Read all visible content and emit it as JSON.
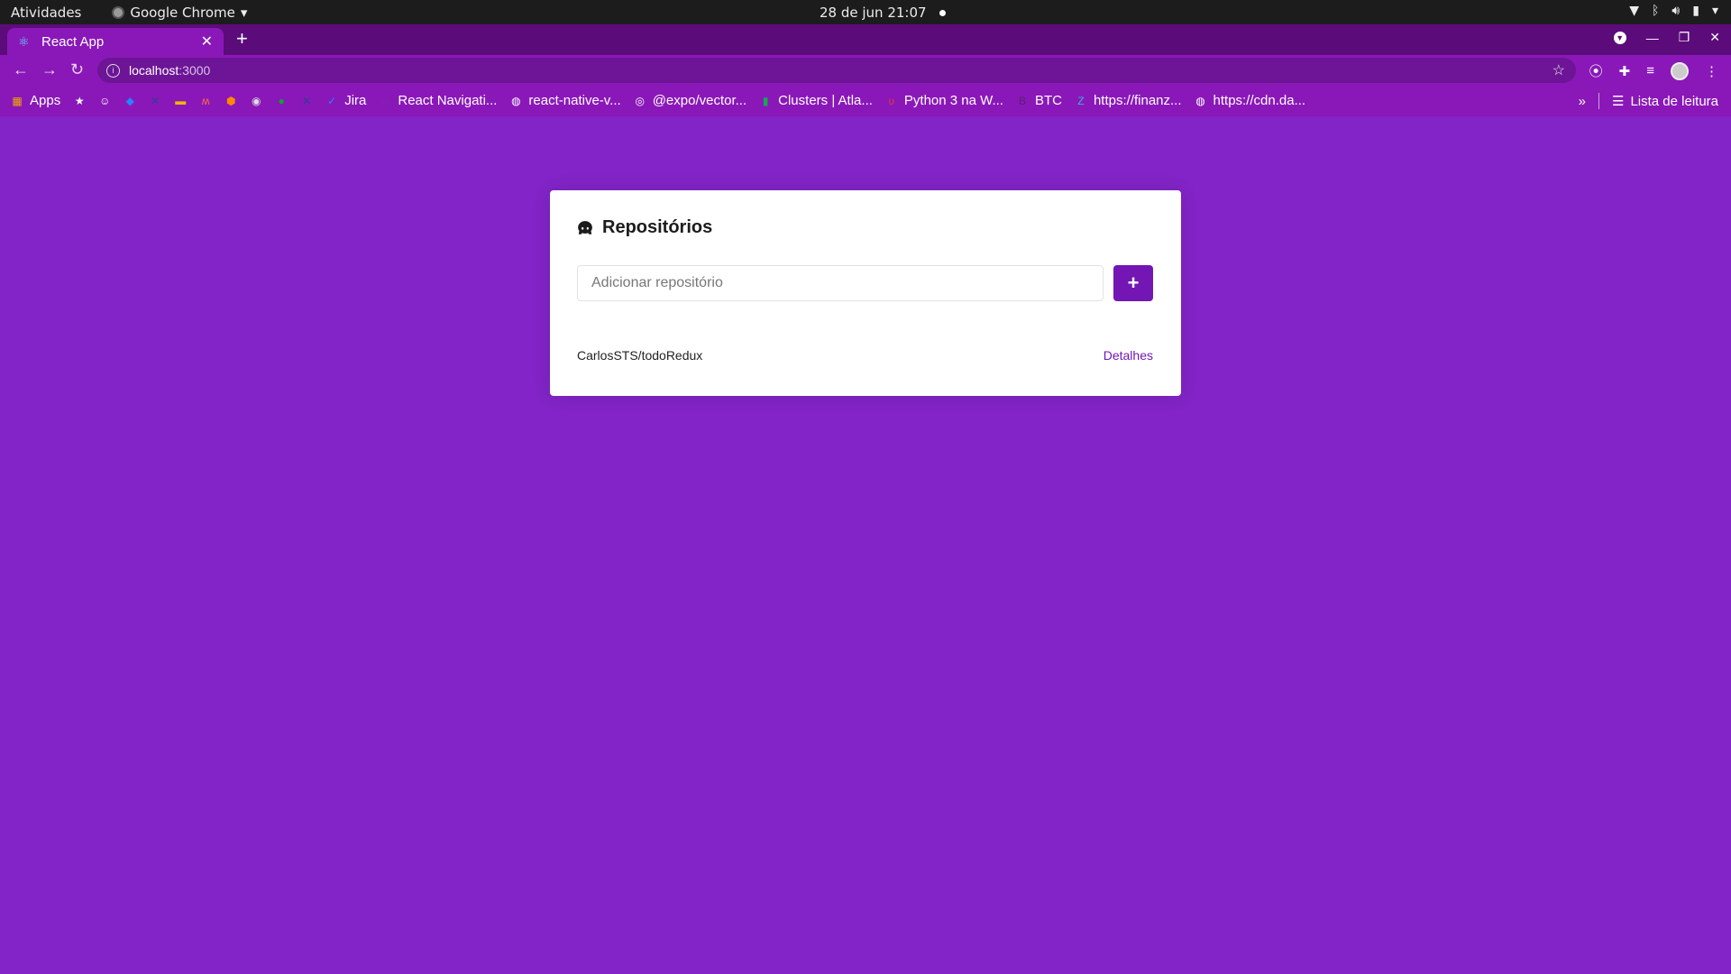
{
  "system_bar": {
    "activities": "Atividades",
    "app_name": "Google Chrome",
    "datetime": "28 de jun  21:07"
  },
  "browser": {
    "tab": {
      "title": "React App"
    },
    "url_host": "localhost",
    "url_port": ":3000",
    "bookmarks": [
      {
        "label": "Apps",
        "icon": "apps-grid-icon",
        "color": "#f2a900"
      },
      {
        "label": "",
        "icon": "star-icon",
        "color": "#ffffff"
      },
      {
        "label": "",
        "icon": "smiley-icon",
        "color": "#ffffff"
      },
      {
        "label": "",
        "icon": "bitbucket-icon",
        "color": "#2684ff"
      },
      {
        "label": "",
        "icon": "x-icon",
        "color": "#2d3e8f"
      },
      {
        "label": "",
        "icon": "card-icon",
        "color": "#f4b400"
      },
      {
        "label": "",
        "icon": "m-icon",
        "color": "#ff6d3b"
      },
      {
        "label": "",
        "icon": "box-icon",
        "color": "#ff8a00"
      },
      {
        "label": "",
        "icon": "postman-icon",
        "color": "#dddddd"
      },
      {
        "label": "",
        "icon": "evernote-icon",
        "color": "#00a82d"
      },
      {
        "label": "",
        "icon": "x-icon",
        "color": "#2d3e8f"
      },
      {
        "label": "Jira",
        "icon": "jira-icon",
        "color": "#2684ff"
      },
      {
        "label": "React Navigati...",
        "icon": "react-navigation-icon",
        "color": "#6b3fa0"
      },
      {
        "label": "react-native-v...",
        "icon": "globe-icon",
        "color": "#ffffff"
      },
      {
        "label": "@expo/vector...",
        "icon": "expo-icon",
        "color": "#ffffff"
      },
      {
        "label": "Clusters | Atla...",
        "icon": "mongodb-leaf-icon",
        "color": "#13aa52"
      },
      {
        "label": "Python 3 na W...",
        "icon": "python-icon",
        "color": "#e53935"
      },
      {
        "label": "BTC",
        "icon": "btc-icon",
        "color": "#5a1e7a"
      },
      {
        "label": "https://finanz...",
        "icon": "finance-icon",
        "color": "#3ab0e0"
      },
      {
        "label": "https://cdn.da...",
        "icon": "globe-icon",
        "color": "#ffffff"
      }
    ],
    "reading_list": "Lista de leitura"
  },
  "page": {
    "title": "Repositórios",
    "input_placeholder": "Adicionar repositório",
    "add_button_label": "+",
    "repositories": [
      {
        "name": "CarlosSTS/todoRedux",
        "link_label": "Detalhes"
      }
    ]
  },
  "colors": {
    "background": "#8224c7",
    "accent": "#7316b3"
  }
}
